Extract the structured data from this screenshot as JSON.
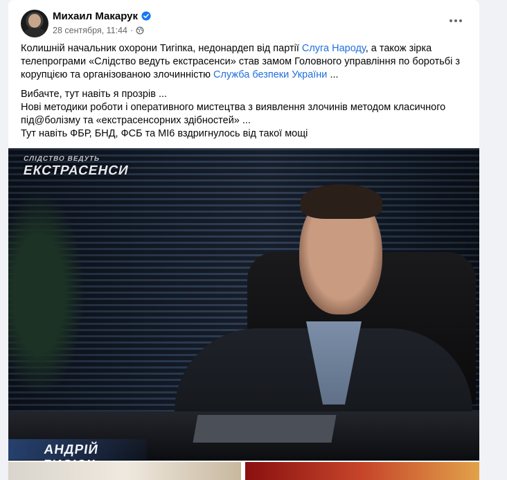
{
  "post": {
    "author": "Михаил Макарук",
    "verified_icon": "verified-badge-icon",
    "timestamp": "28 сентября, 11:44",
    "meta_separator": "·",
    "privacy_icon": "globe-icon",
    "menu_icon": "more-options-icon",
    "paragraph1": {
      "part1": "Колишній начальник охорони Тигіпка, недонардеп від партії ",
      "link1": "Слуга Народу",
      "part2": ", а також зірка телепрограми «Слідство ведуть екстрасенси» став замом Головного управління по боротьбі з корупцією та організованою злочинністю ",
      "link2": "Служба безпеки України",
      "part3": "  ..."
    },
    "paragraph2": {
      "line1": "Вибачте, тут навіть я прозрів ...",
      "line2": "Нові методики роботи і оперативного мистецтва з виявлення злочинів методом класичного під@болізму та «екстрасенсорних здібностей» ...",
      "line3": "Тут навіть ФБР, БНД, ФСБ та МІ6  вздригнулось від такої мощі"
    }
  },
  "photo": {
    "show_logo_top": "СЛІДСТВО ВЕДУТЬ",
    "show_logo_main": "ЕКСТРАСЕНСИ",
    "caption_name": "АНДРІЙ ЛИСЮК"
  },
  "colors": {
    "link": "#216fdb",
    "secondary_text": "#65676b",
    "background": "#f0f2f5",
    "verified": "#1877f2"
  }
}
